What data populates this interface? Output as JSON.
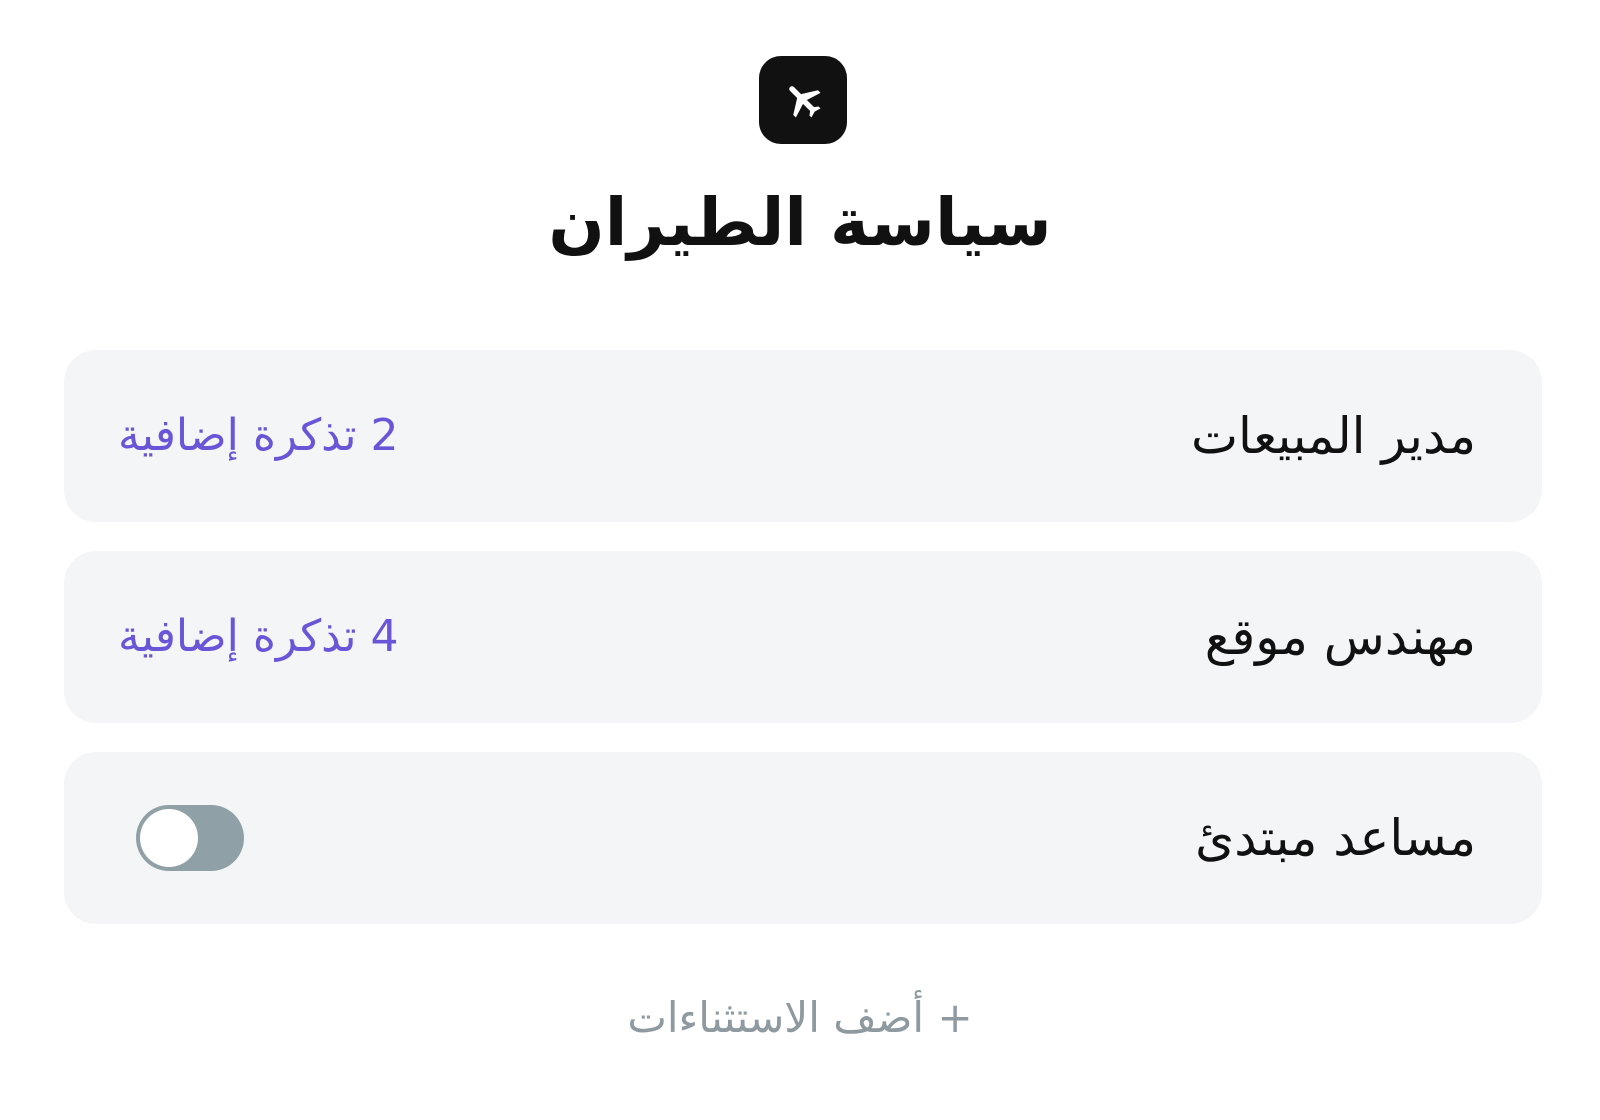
{
  "header": {
    "icon": "airplane-icon",
    "title": "سياسة الطيران"
  },
  "policies": [
    {
      "role": "مدير المبيعات",
      "extra_tickets": "2 تذكرة إضافية"
    },
    {
      "role": "مهندس موقع",
      "extra_tickets": "4 تذكرة إضافية"
    },
    {
      "role": "مساعد مبتدئ",
      "toggle_enabled": false
    }
  ],
  "add_exceptions_label": "+ أضف الاستثناءات",
  "colors": {
    "accent": "#6a55d8",
    "card_background": "#f4f5f6",
    "toggle_off": "#8fa0a6",
    "muted_text": "#8e9aa0",
    "icon_background": "#111111"
  }
}
